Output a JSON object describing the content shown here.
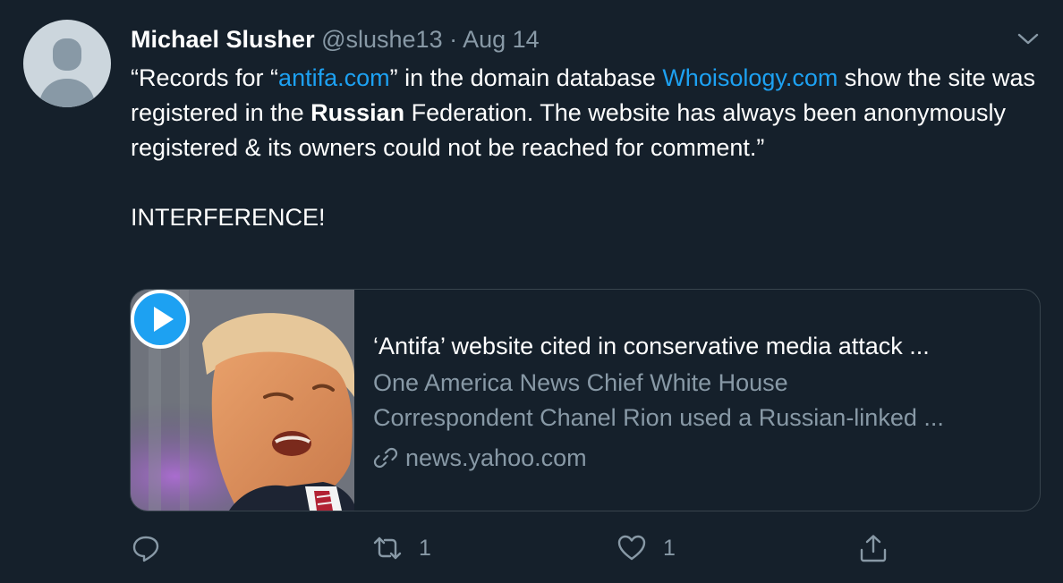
{
  "tweet": {
    "author_name": "Michael Slusher",
    "author_handle": "@slushe13",
    "separator": "·",
    "date": "Aug 14",
    "text": {
      "quote_open": "“Records for “",
      "link1": "antifa.com",
      "part2": "” in the domain database ",
      "link2": "Whoisology.com",
      "part3": " show the site was registered in the ",
      "bold": "Russian",
      "part4": " Federation. The website has always been anonymously registered & its owners could not be reached for comment.”",
      "second_paragraph": "INTERFERENCE!"
    }
  },
  "card": {
    "title": "‘Antifa’ website cited in conservative media attack ...",
    "description_line1": "One America News Chief White House",
    "description_line2": "Correspondent Chanel Rion used a Russian-linked ...",
    "domain": "news.yahoo.com",
    "has_video": true
  },
  "actions": {
    "reply_count": "",
    "retweet_count": "1",
    "like_count": "1"
  },
  "colors": {
    "background": "#15202b",
    "link": "#1da1f2",
    "muted": "#8899a6",
    "border": "#38444d"
  },
  "icons": [
    "avatar-placeholder",
    "chevron-down-icon",
    "play-icon",
    "link-icon",
    "reply-icon",
    "retweet-icon",
    "like-icon",
    "share-icon"
  ]
}
